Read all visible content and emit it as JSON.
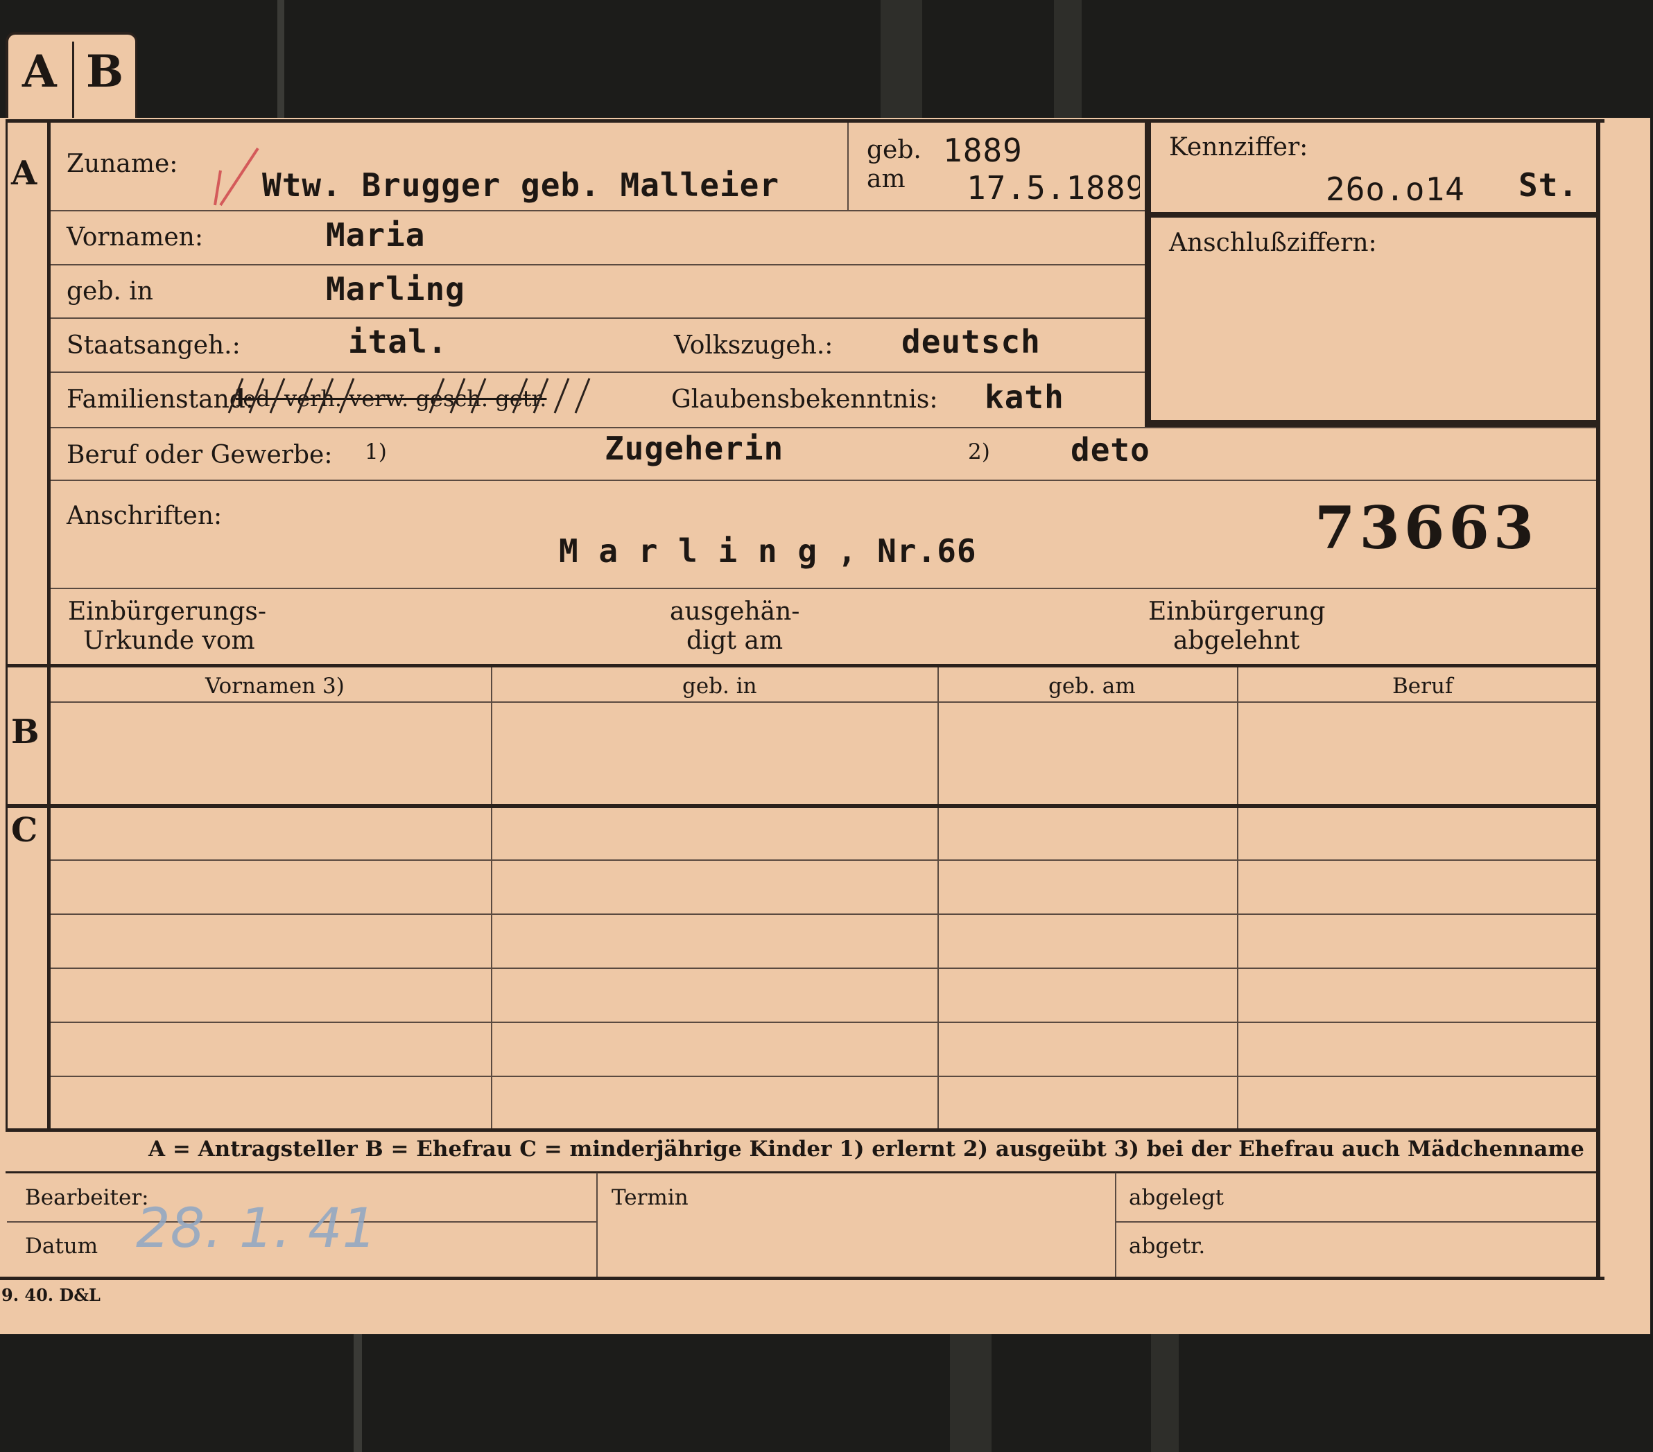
{
  "tabs": {
    "a": "A",
    "b": "B"
  },
  "sections": {
    "a": "A",
    "b": "B",
    "c": "C"
  },
  "labels": {
    "zuname": "Zuname:",
    "geb_year": "geb.",
    "am": "am",
    "kennziffer": "Kennziffer:",
    "vornamen": "Vornamen:",
    "anschlussziffern": "Anschlußziffern:",
    "geb_in": "geb. in",
    "staatsangeh": "Staatsangeh.:",
    "volkszugeh": "Volkszugeh.:",
    "familienstand": "Familienstand:",
    "familienstand_options": "led. verh. verw. gesch. getr.",
    "glaubensbekenntnis": "Glaubensbekenntnis:",
    "beruf": "Beruf oder Gewerbe:",
    "fn1": "1)",
    "fn2": "2)",
    "anschriften": "Anschriften:",
    "einbuergerung_urkunde_1": "Einbürgerungs-",
    "einbuergerung_urkunde_2": "Urkunde vom",
    "ausgehaendigt_1": "ausgehän-",
    "ausgehaendigt_2": "digt am",
    "einbuergerung_abgelehnt_1": "Einbürgerung",
    "einbuergerung_abgelehnt_2": "abgelehnt",
    "bearbeiter": "Bearbeiter:",
    "datum": "Datum",
    "termin": "Termin",
    "abgelegt": "abgelegt",
    "abgetr": "abgetr.",
    "printer": "9. 40. D&L"
  },
  "values": {
    "zuname": "Wtw. Brugger  geb. Malleier",
    "geb_year": "1889",
    "geb_date": "17.5.1889",
    "kennziffer": "26o.o14",
    "kennziffer_suffix": "St.",
    "vornamen": "Maria",
    "geb_in": "Marling",
    "staatsangeh": "ital.",
    "volkszugeh": "deutsch",
    "glaubensbekenntnis": "kath",
    "beruf_erlernt": "Zugeherin",
    "beruf_ausgeuebt": "deto",
    "anschrift": "M a r l i n g , Nr.66",
    "stamp_number": "73663",
    "datum_hand": "28. 1. 41"
  },
  "table_b": {
    "headers": [
      "Vornamen 3)",
      "geb. in",
      "geb. am",
      "Beruf"
    ]
  },
  "legend": "A = Antragsteller   B = Ehefrau   C = minderjährige Kinder   1) erlernt   2) ausgeübt   3) bei der Ehefrau auch Mädchenname"
}
